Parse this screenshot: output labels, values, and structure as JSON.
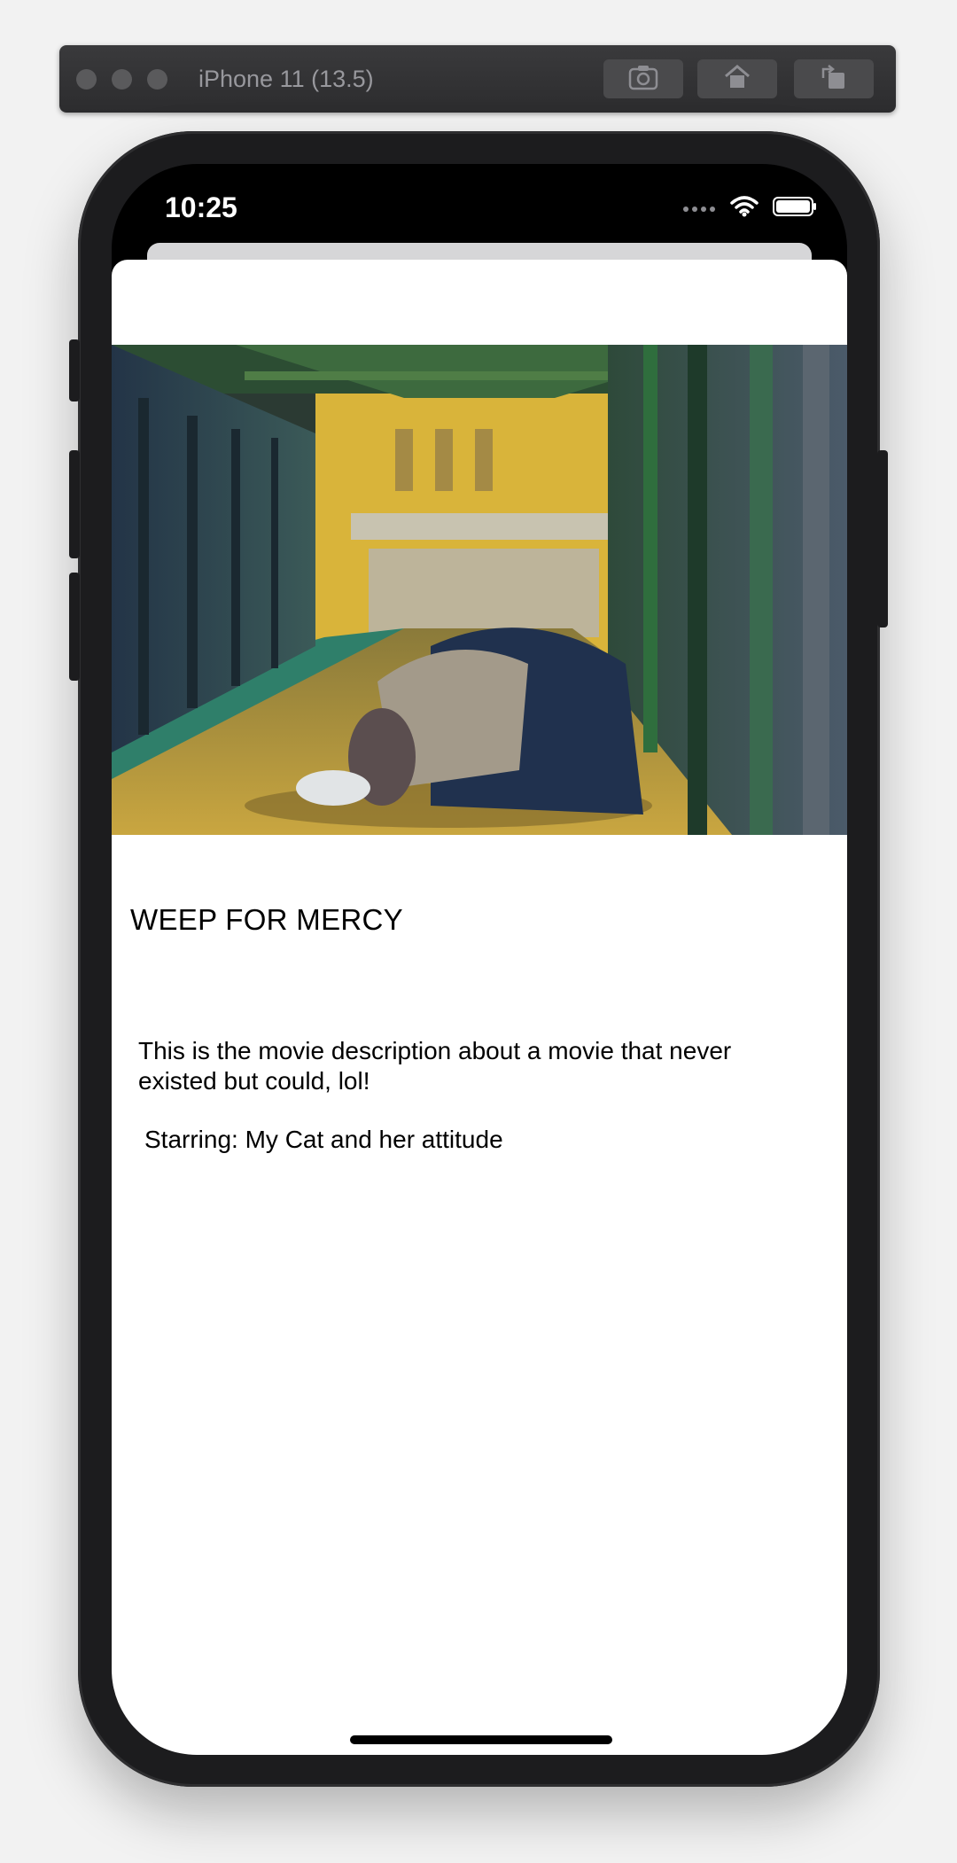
{
  "simulator": {
    "device_title": "iPhone 11 (13.5)",
    "buttons": [
      {
        "icon": "camera-icon"
      },
      {
        "icon": "home-icon"
      },
      {
        "icon": "rotate-icon"
      }
    ]
  },
  "status_bar": {
    "time": "10:25",
    "icons": [
      "signal-dots-icon",
      "wifi-icon",
      "battery-icon"
    ]
  },
  "movie": {
    "image_icon": "poster-image",
    "title": "WEEP FOR MERCY",
    "description": "This is the movie description about a movie that never existed but could, lol!",
    "starring": "Starring: My Cat and her attitude"
  },
  "colors": {
    "sim_bar": "#2c2c2e",
    "phone_body": "#1c1c1e",
    "sheet": "#ffffff"
  }
}
